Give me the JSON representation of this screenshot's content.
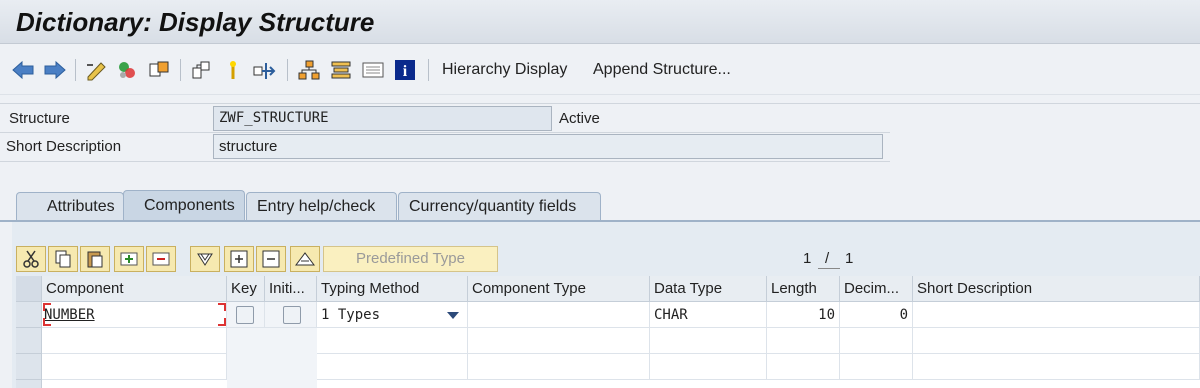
{
  "window": {
    "title": "Dictionary: Display Structure"
  },
  "toolbar": {
    "icons": [
      "back-arrow-icon",
      "forward-arrow-icon",
      "display-change-icon",
      "activate-icon",
      "object-list-icon",
      "where-used-icon",
      "where-used-list-icon",
      "navigation-icon",
      "hierarchy-icon",
      "stack-icon",
      "info-list-icon",
      "info-icon"
    ],
    "hierarchy_display": "Hierarchy Display",
    "append_structure": "Append Structure..."
  },
  "header": {
    "structure_label": "Structure",
    "structure_value": "ZWF_STRUCTURE",
    "status": "Active",
    "short_desc_label": "Short Description",
    "short_desc_value": "structure"
  },
  "tabs": [
    {
      "label": "Attributes",
      "active": false
    },
    {
      "label": "Components",
      "active": true
    },
    {
      "label": "Entry help/check",
      "active": false
    },
    {
      "label": "Currency/quantity fields",
      "active": false
    }
  ],
  "table_toolbar": {
    "icons": [
      "cut-icon",
      "copy-icon",
      "paste-icon",
      "insert-row-icon",
      "delete-row-icon",
      "find-icon",
      "insert-icon",
      "remove-icon",
      "sort-icon"
    ],
    "predefined_type_label": "Predefined Type",
    "page_current": "1",
    "page_sep": "/",
    "page_total": "1"
  },
  "table": {
    "columns": [
      "Component",
      "Key",
      "Initi...",
      "Typing Method",
      "Component Type",
      "Data Type",
      "Length",
      "Decim...",
      "Short Description"
    ],
    "rows": [
      {
        "component": "NUMBER",
        "key": false,
        "initial": false,
        "typing_method": "1 Types",
        "component_type": "",
        "data_type": "CHAR",
        "length": "10",
        "decimals": "0",
        "short_description": ""
      }
    ]
  },
  "colors": {
    "title_bg": "#dbe1e8",
    "tab_border": "#9fb2c8",
    "button_yellow": "#f6e9b0",
    "accent_red": "#d33"
  }
}
